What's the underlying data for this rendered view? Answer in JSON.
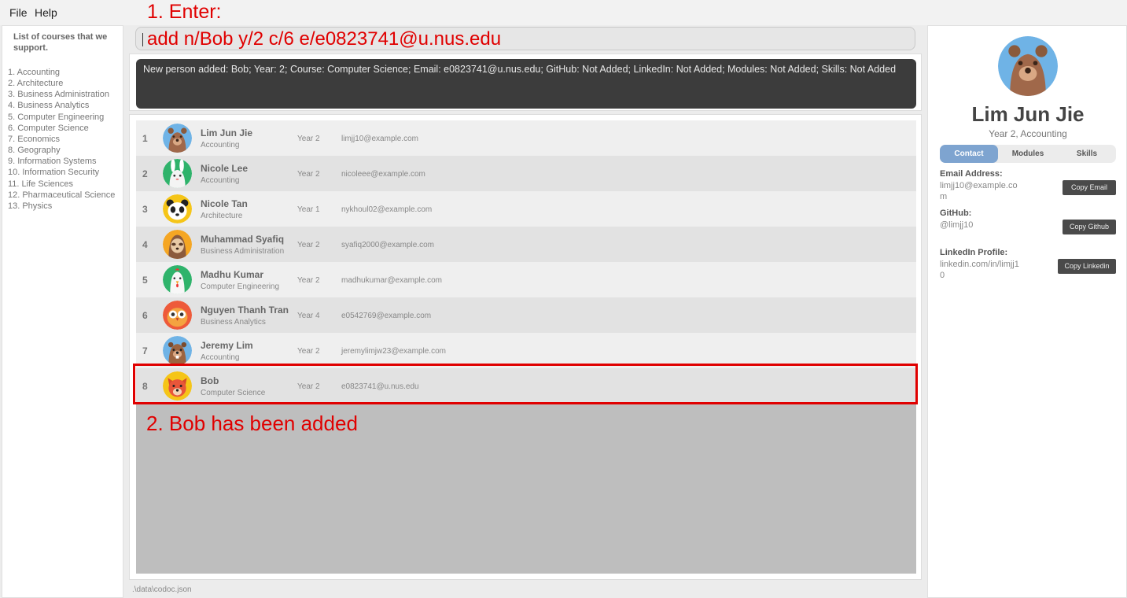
{
  "menu": {
    "file": "File",
    "help": "Help"
  },
  "annotations": {
    "step1": "1.  Enter:",
    "step2": "2. Bob has been added"
  },
  "courses": {
    "title": "List of courses that we support.",
    "items": [
      "1. Accounting",
      "2. Architecture",
      "3. Business Administration",
      "4. Business Analytics",
      "5. Computer Engineering",
      "6. Computer Science",
      "7. Economics",
      "8. Geography",
      "9. Information Systems",
      "10. Information Security",
      "11. Life Sciences",
      "12. Pharmaceutical Science",
      "13. Physics"
    ]
  },
  "command": {
    "value": "add n/Bob y/2 c/6 e/e0823741@u.nus.edu"
  },
  "result": {
    "text": "New person added: Bob; Year: 2; Course: Computer Science; Email: e0823741@u.nus.edu; GitHub: Not Added; LinkedIn: Not Added; Modules: Not Added; Skills: Not Added"
  },
  "persons": [
    {
      "index": "1",
      "name": "Lim Jun Jie",
      "course": "Accounting",
      "year": "Year 2",
      "email": "limjj10@example.com",
      "avatar": "bear-icon"
    },
    {
      "index": "2",
      "name": "Nicole Lee",
      "course": "Accounting",
      "year": "Year 2",
      "email": "nicoleee@example.com",
      "avatar": "rabbit-icon"
    },
    {
      "index": "3",
      "name": "Nicole Tan",
      "course": "Architecture",
      "year": "Year 1",
      "email": "nykhoul02@example.com",
      "avatar": "panda-icon"
    },
    {
      "index": "4",
      "name": "Muhammad Syafiq",
      "course": "Business Administration",
      "year": "Year 2",
      "email": "syafiq2000@example.com",
      "avatar": "sloth-icon"
    },
    {
      "index": "5",
      "name": "Madhu Kumar",
      "course": "Computer Engineering",
      "year": "Year 2",
      "email": "madhukumar@example.com",
      "avatar": "chicken-icon"
    },
    {
      "index": "6",
      "name": "Nguyen Thanh Tran",
      "course": "Business Analytics",
      "year": "Year 4",
      "email": "e0542769@example.com",
      "avatar": "owl-icon"
    },
    {
      "index": "7",
      "name": "Jeremy Lim",
      "course": "Accounting",
      "year": "Year 2",
      "email": "jeremylimjw23@example.com",
      "avatar": "beaver-icon"
    },
    {
      "index": "8",
      "name": "Bob",
      "course": "Computer Science",
      "year": "Year 2",
      "email": "e0823741@u.nus.edu",
      "avatar": "fox-icon"
    }
  ],
  "status": {
    "path": ".\\data\\codoc.json"
  },
  "details": {
    "name": "Lim Jun Jie",
    "subtitle": "Year 2, Accounting",
    "avatar": "bear-icon",
    "tabs": [
      "Contact",
      "Modules",
      "Skills"
    ],
    "active_tab": "Contact",
    "email_label": "Email Address:",
    "email_value": "limjj10@example.com",
    "copy_email": "Copy Email",
    "github_label": "GitHub:",
    "github_value": "@limjj10",
    "copy_github": "Copy Github",
    "linkedin_label": "LinkedIn Profile:",
    "linkedin_value": "linkedin.com/in/limjj10",
    "copy_linkedin": "Copy Linkedin"
  },
  "colors": {
    "accent": "#7ea4d0",
    "annotation": "#e00000",
    "result_bg": "#3c3c3c"
  }
}
